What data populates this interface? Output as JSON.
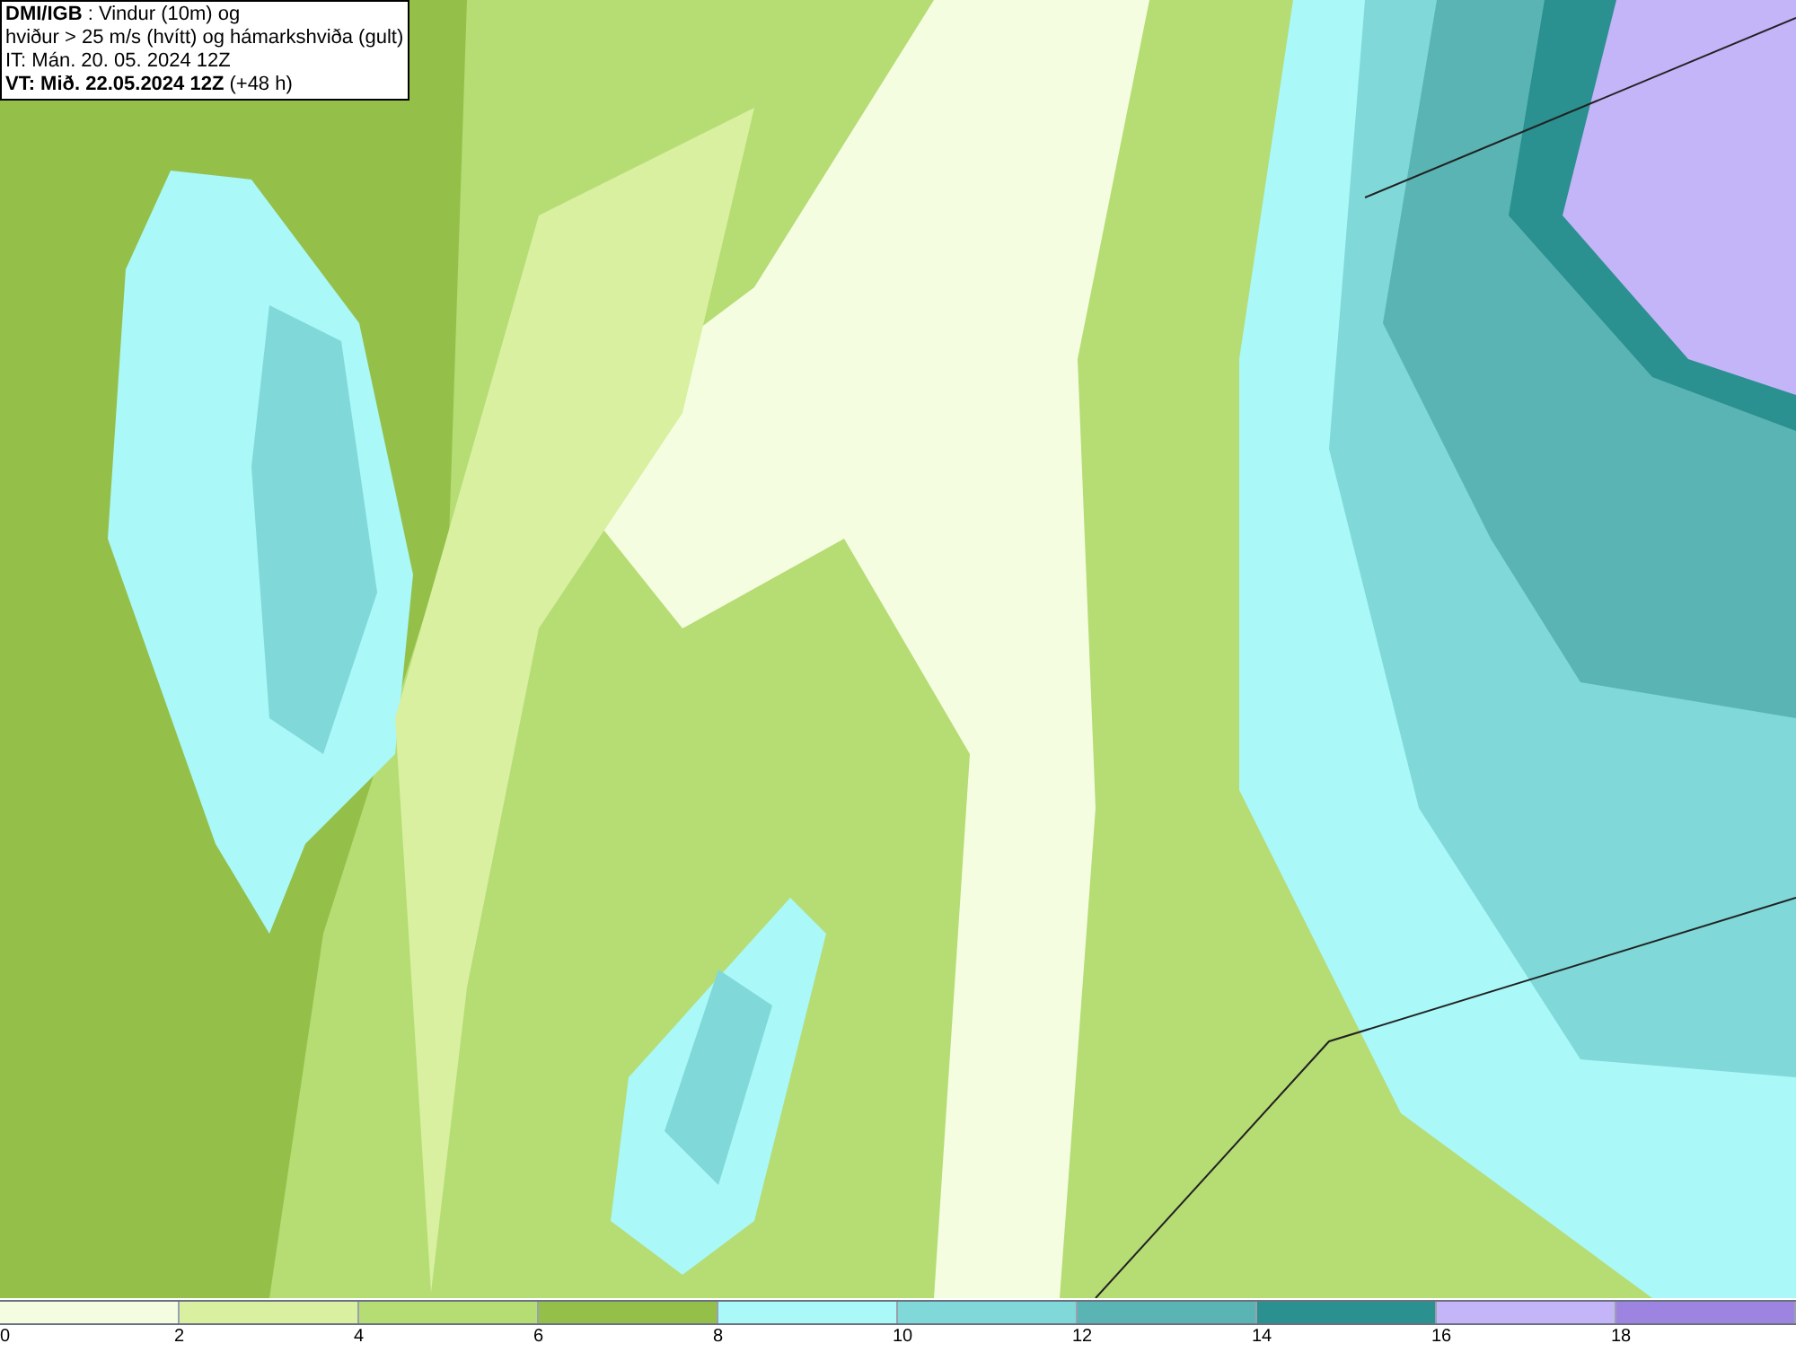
{
  "header": {
    "lines": [
      "**DMI/IGB** : Vindur (10m) og",
      "hviður > 25 m/s (hvítt) og hámarkshviða (gult)",
      "IT: Mán. 20. 05. 2024 12Z",
      "**VT: Mið. 22.05.2024 12Z** (+48 h)"
    ]
  },
  "legend": {
    "bins": [
      {
        "label": "0",
        "color": "#f4fde0"
      },
      {
        "label": "2",
        "color": "#d8f0a0"
      },
      {
        "label": "4",
        "color": "#b6dc74"
      },
      {
        "label": "6",
        "color": "#94c04a"
      },
      {
        "label": "8",
        "color": "#aaf8f8"
      },
      {
        "label": "10",
        "color": "#80d8d8"
      },
      {
        "label": "12",
        "color": "#5ab4b4"
      },
      {
        "label": "14",
        "color": "#2a9090"
      },
      {
        "label": "16",
        "color": "#c4b4f8"
      },
      {
        "label": "18",
        "color": "#9c84e0"
      }
    ]
  }
}
